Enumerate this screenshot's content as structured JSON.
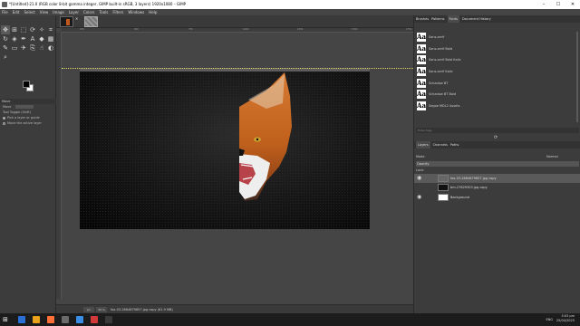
{
  "window": {
    "title": "*[Untitled]-21.0 (RGB color 8-bit gamma integer, GIMP built-in sRGB, 3 layers) 1920x1080 – GIMP",
    "controls": [
      "–",
      "☐",
      "✕"
    ]
  },
  "menu": [
    "File",
    "Edit",
    "Select",
    "View",
    "Image",
    "Layer",
    "Colors",
    "Tools",
    "Filters",
    "Windows",
    "Help"
  ],
  "image_tabs": {
    "close_glyph": "✕"
  },
  "ruler_ticks": [
    "250",
    "500",
    "750",
    "1000",
    "1250",
    "1500",
    "1750"
  ],
  "tool_options": {
    "header": "Move",
    "mode_label": "Move",
    "toggle_label": "Tool Toggle (Shift)",
    "options": [
      "Pick a layer or guide",
      "Move the active layer"
    ]
  },
  "dock_top": {
    "tabs": [
      "Brushes",
      "Patterns",
      "Fonts",
      "Document History"
    ],
    "selected_tab": 2,
    "fonts": [
      "Sans-serif",
      "Sans-serif Bold",
      "Sans-serif Bold Italic",
      "Sans-serif Italic",
      "Schadow BT",
      "Schadow BT Bold",
      "Segoe MDL2 Assets"
    ],
    "filter_placeholder": "Enter tags",
    "refresh_glyph": "⟳"
  },
  "layers": {
    "tabs": [
      "Layers",
      "Channels",
      "Paths"
    ],
    "selected_tab": 0,
    "mode_label": "Mode",
    "mode_value": "Normal",
    "opacity_label": "Opacity",
    "lock_label": "Lock:",
    "items": [
      {
        "name": "fox-03-2664679857.jpg copy",
        "visible": true,
        "selected": true,
        "thumb": "#666666"
      },
      {
        "name": "bm-27629303.jpg copy",
        "visible": false,
        "selected": false,
        "thumb": "#111111"
      },
      {
        "name": "Background",
        "visible": true,
        "selected": false,
        "thumb": "#ffffff"
      }
    ]
  },
  "status": {
    "unit": "px",
    "zoom": "25 %",
    "info": "fox-03-2664679857.jpg copy (61.9 MB)"
  },
  "taskbar": {
    "lang": "ENG",
    "time": "3:03 pm",
    "date": "25/04/2025"
  },
  "colors": {
    "accent": "#c05a1e",
    "fg": "#000000",
    "bg": "#ffffff"
  }
}
